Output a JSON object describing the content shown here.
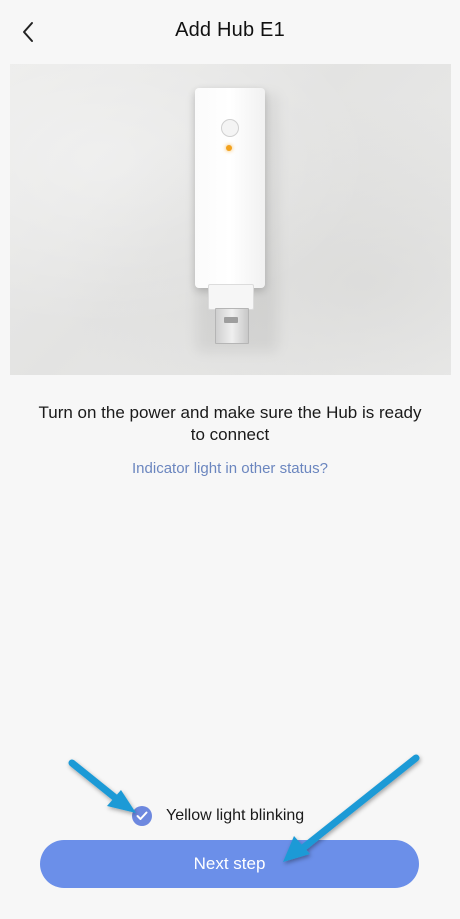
{
  "header": {
    "title": "Add Hub E1",
    "back_icon": "chevron-left-icon"
  },
  "main": {
    "instruction": "Turn on the power and make sure the Hub is ready to connect",
    "help_link": "Indicator light in other status?"
  },
  "confirmation": {
    "label": "Yellow light blinking",
    "checked": true,
    "check_icon": "checkmark-icon"
  },
  "footer": {
    "next_button": "Next step"
  },
  "colors": {
    "accent": "#6b8fe9",
    "link": "#6b86bf",
    "annotation_arrow": "#1d9ad6",
    "led": "#f3a21d"
  }
}
